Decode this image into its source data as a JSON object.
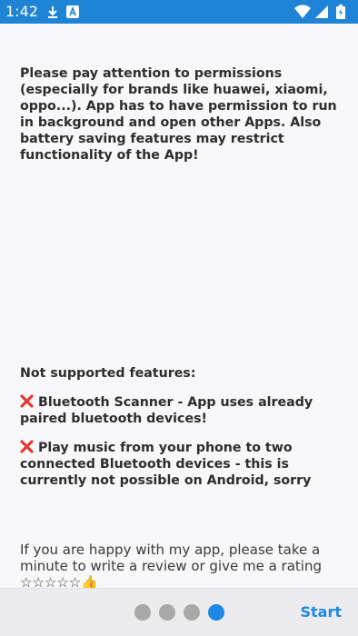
{
  "status_bar": {
    "time": "1:42",
    "icons_left": [
      "download-icon",
      "a-box-icon"
    ],
    "icons_right": [
      "wifi-icon",
      "signal-icon",
      "battery-icon"
    ],
    "color": "#1f84d6"
  },
  "content": {
    "permissions_text": "Please pay attention to permissions (especially for brands like huawei, xiaomi, oppo...). App has to have permission to run in background and open other Apps. Also battery saving features may restrict functionality of the App!",
    "not_supported_heading": "Not supported features:",
    "feature_1": "Bluetooth Scanner - App uses already paired bluetooth devices!",
    "feature_2": "Play music from your phone to two connected Bluetooth devices - this is currently not possible on Android, sorry",
    "review_text": "If you are happy with my app, please take a minute to write a review or give me a rating ☆☆☆☆☆👍",
    "cross_icon": "cross-mark-icon",
    "cross_color": "#e53935"
  },
  "bottom_bar": {
    "page_indicator": {
      "total": 4,
      "active_index": 3
    },
    "start_label": "Start",
    "accent_color": "#1e88e5"
  }
}
